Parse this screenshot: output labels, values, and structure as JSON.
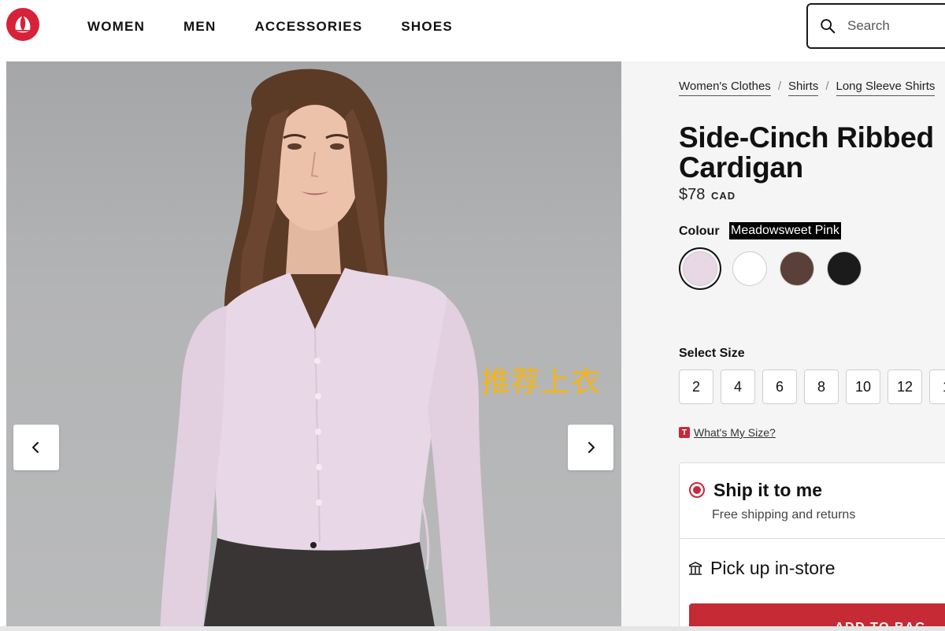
{
  "header": {
    "nav": [
      "WOMEN",
      "MEN",
      "ACCESSORIES",
      "SHOES"
    ],
    "search_placeholder": "Search"
  },
  "gallery": {
    "overlay_text": "推荐上衣"
  },
  "product": {
    "breadcrumb": [
      "Women's Clothes",
      "Shirts",
      "Long Sleeve Shirts"
    ],
    "title": "Side-Cinch Ribbed Cardigan",
    "price": "$78",
    "currency": "CAD",
    "colour_label": "Colour",
    "colour_value": "Meadowsweet Pink",
    "swatches": [
      {
        "name": "Meadowsweet Pink",
        "color": "#e8d8e6",
        "selected": true
      },
      {
        "name": "White",
        "color": "#ffffff",
        "selected": false
      },
      {
        "name": "Brown",
        "color": "#5a4038",
        "selected": false
      },
      {
        "name": "Black",
        "color": "#1b1b1b",
        "selected": false
      }
    ],
    "size_label": "Select Size",
    "sizes": [
      "2",
      "4",
      "6",
      "8",
      "10",
      "12",
      "1"
    ],
    "size_help_badge": "T",
    "size_help": "What's My Size?",
    "ship_title": "Ship it to me",
    "ship_sub": "Free shipping and returns",
    "pickup": "Pick up in-store",
    "add_to_bag": "ADD TO BAG"
  },
  "colors": {
    "brand_red": "#d6233a",
    "button_red": "#c62a34"
  }
}
